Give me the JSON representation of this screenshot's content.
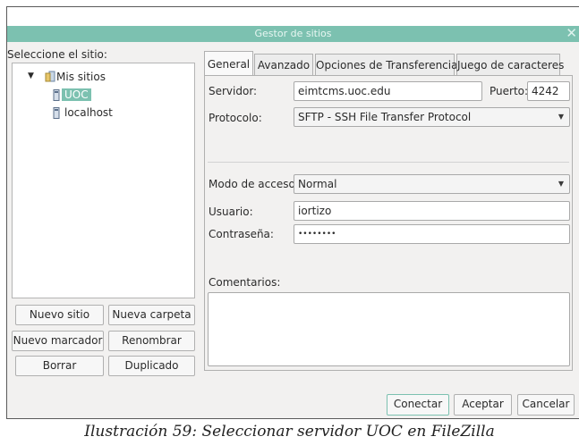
{
  "window": {
    "title": "Gestor de sitios",
    "close_glyph": "✕"
  },
  "sidebar": {
    "label": "Seleccione el sitio:",
    "tree": {
      "root_label": "Mis sitios",
      "items": [
        {
          "label": "UOC",
          "selected": true
        },
        {
          "label": "localhost",
          "selected": false
        }
      ]
    },
    "buttons": {
      "new_site": "Nuevo sitio",
      "new_folder": "Nueva carpeta",
      "new_bookmark": "Nuevo marcador",
      "rename": "Renombrar",
      "delete": "Borrar",
      "duplicate": "Duplicado"
    }
  },
  "tabs": [
    {
      "label": "General",
      "active": true
    },
    {
      "label": "Avanzado",
      "active": false
    },
    {
      "label": "Opciones de Transferencia",
      "active": false
    },
    {
      "label": "Juego de caracteres",
      "active": false
    }
  ],
  "form": {
    "server_label": "Servidor:",
    "server_value": "eimtcms.uoc.edu",
    "port_label": "Puerto:",
    "port_value": "4242",
    "protocol_label": "Protocolo:",
    "protocol_value": "SFTP - SSH File Transfer Protocol",
    "access_label": "Modo de acceso:",
    "access_value": "Normal",
    "user_label": "Usuario:",
    "user_value": "iortizo",
    "password_label": "Contraseña:",
    "password_value": "••••••••",
    "comments_label": "Comentarios:",
    "comments_value": ""
  },
  "footer": {
    "connect": "Conectar",
    "accept": "Aceptar",
    "cancel": "Cancelar"
  },
  "caption": "Ilustración 59: Seleccionar servidor UOC en FileZilla",
  "colors": {
    "accent": "#7cc1b0",
    "window_bg": "#f2f1f0"
  }
}
